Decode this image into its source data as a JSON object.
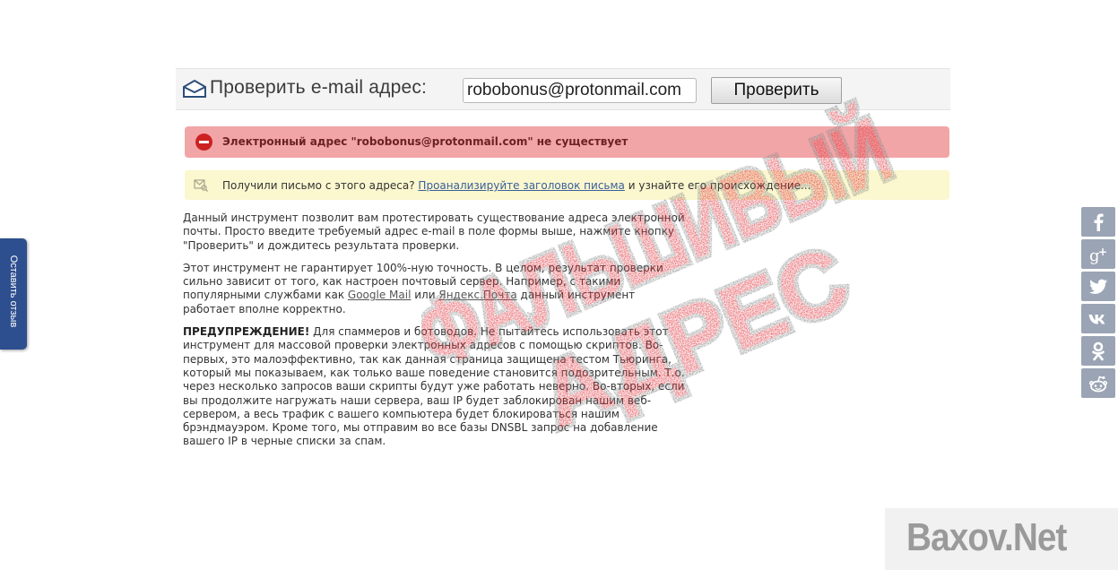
{
  "checker": {
    "title": "Проверить e-mail адрес:",
    "email_value": "robobonus@protonmail.com",
    "button_label": "Проверить"
  },
  "error": {
    "message": "Электронный адрес \"robobonus@protonmail.com\" не существует"
  },
  "info": {
    "before": "Получили письмо с этого адреса?",
    "link": "Проанализируйте заголовок письма",
    "after": "и узнайте его происхождение..."
  },
  "content": {
    "p1": "Данный инструмент позволит вам протестировать существование адреса электронной почты. Просто введите требуемый адрес e-mail в поле формы выше, нажмите кнопку \"Проверить\" и дождитесь результата проверки.",
    "p2_before": "Этот инструмент не гарантирует 100%-ную точность. В целом, результат проверки сильно зависит от того, как настроен почтовый сервер. Например, с такими популярными службами как",
    "p2_link1": "Google Mail",
    "p2_mid": "или",
    "p2_link2": "Яндекс.Почта",
    "p2_after": "данный инструмент работает вполне корректно.",
    "p3_bold": "ПРЕДУПРЕЖДЕНИЕ!",
    "p3_text": "Для спаммеров и ботоводов. Не пытайтесь использовать этот инструмент для массовой проверки электронных адресов с помощью скриптов. Во-первых, это малоэффективно, так как данная страница защищена тестом Тьюринга, который мы показываем, как только ваше поведение становится подозрительным. Т.о. через несколько запросов ваши скрипты будут уже работать неверно. Во-вторых, если вы продолжите нагружать наши сервера, ваш IP будет заблокирован нашим веб-сервером, а весь трафик с вашего компьютера будет блокироваться нашим брэндмауэром. Кроме того, мы отправим во все базы DNSBL запрос на добавление вашего IP в черные списки за спам."
  },
  "stamp": {
    "line1": "ФАЛЬШИВЫЙ",
    "line2": "АДРЕС"
  },
  "feedback": {
    "label": "Оставить отзыв"
  },
  "share": {
    "icons": [
      "facebook-icon",
      "google-plus-icon",
      "twitter-icon",
      "vk-icon",
      "odnoklassniki-icon",
      "reddit-icon"
    ]
  },
  "watermark": {
    "text": "Baxov.Net"
  },
  "colors": {
    "error_bg": "#f2a5a7",
    "info_bg": "#fbf7cf",
    "stamp": "#e03a42",
    "feedback_bg": "#2d4f8f",
    "share_bg": "#9aa4b4"
  }
}
